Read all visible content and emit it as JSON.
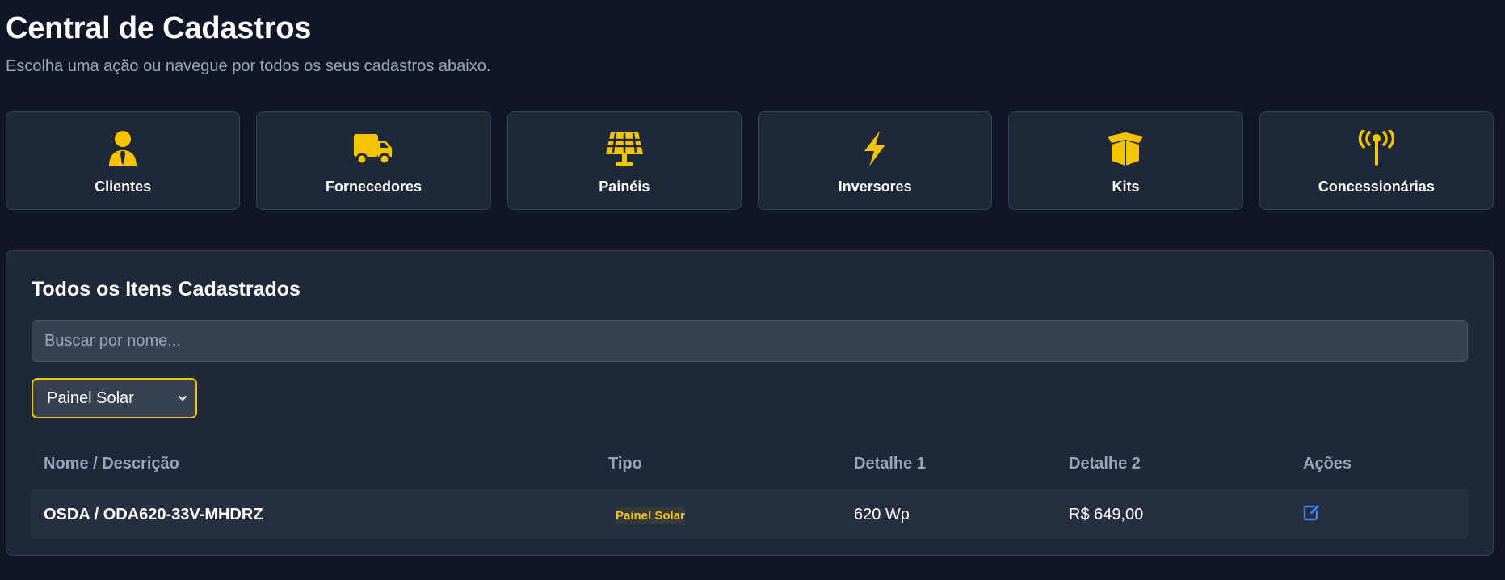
{
  "header": {
    "title": "Central de Cadastros",
    "subtitle": "Escolha uma ação ou navegue por todos os seus cadastros abaixo."
  },
  "colors": {
    "accent": "#f5c400",
    "background": "#0f1626",
    "card": "#1e2838",
    "edit_icon": "#3b82f6"
  },
  "cards": [
    {
      "label": "Clientes",
      "icon": "user-tie-icon"
    },
    {
      "label": "Fornecedores",
      "icon": "truck-icon"
    },
    {
      "label": "Painéis",
      "icon": "solar-panel-icon"
    },
    {
      "label": "Inversores",
      "icon": "bolt-icon"
    },
    {
      "label": "Kits",
      "icon": "box-open-icon"
    },
    {
      "label": "Concessionárias",
      "icon": "broadcast-tower-icon"
    }
  ],
  "panel": {
    "title": "Todos os Itens Cadastrados",
    "search_placeholder": "Buscar por nome...",
    "filter_selected": "Painel Solar"
  },
  "table": {
    "headers": [
      "Nome / Descrição",
      "Tipo",
      "Detalhe 1",
      "Detalhe 2",
      "Ações"
    ],
    "rows": [
      {
        "name": "OSDA / ODA620-33V-MHDRZ",
        "type": "Painel Solar",
        "detail1": "620 Wp",
        "detail2": "R$ 649,00",
        "action": "edit-icon"
      }
    ]
  }
}
